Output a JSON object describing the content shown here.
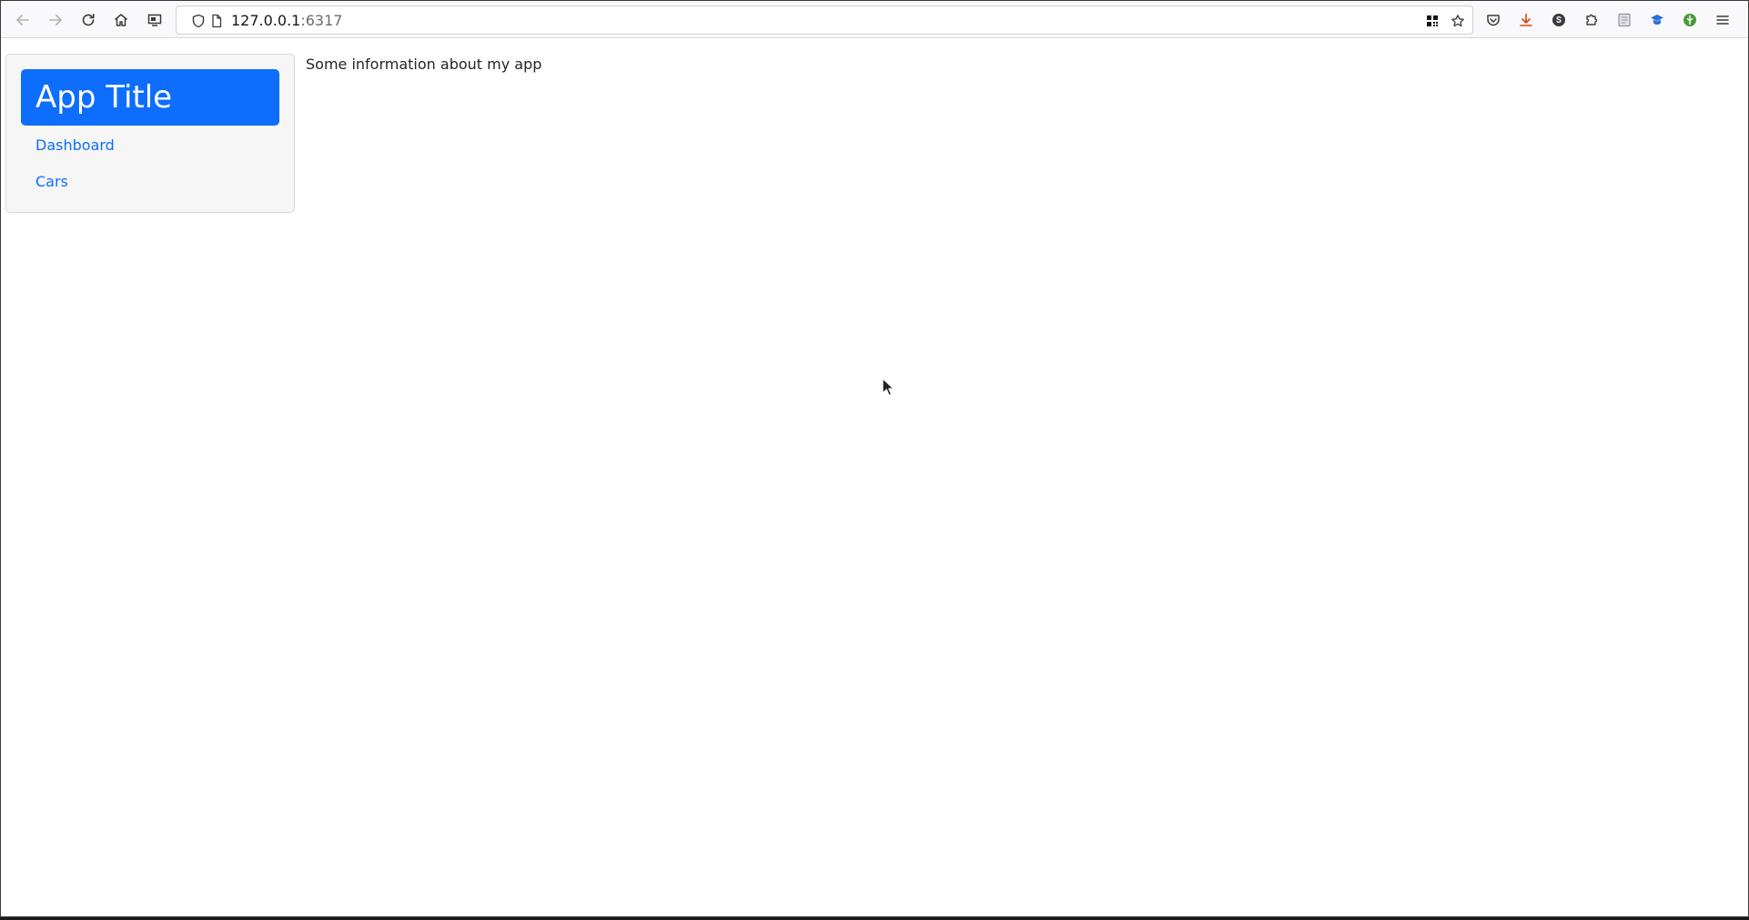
{
  "browser": {
    "url_host": "127.0.0.1",
    "url_port": ":6317",
    "icons": {
      "back": "arrow-left-icon",
      "forward": "arrow-right-icon",
      "reload": "reload-icon",
      "home": "home-icon",
      "screenshot": "screenshot-icon",
      "shield": "shield-icon",
      "page": "page-icon",
      "qr": "qr-code-icon",
      "bookmark": "star-icon",
      "pocket": "pocket-icon",
      "downloads": "download-icon",
      "account": "account-icon",
      "extensions": "puzzle-icon",
      "reader": "reader-icon",
      "extension_blue": "cap-icon",
      "extension_green": "leaf-icon",
      "menu": "hamburger-menu-icon"
    },
    "colors": {
      "download_accent": "#e0431b",
      "toolbar_bg": "#f9f9fb"
    }
  },
  "app": {
    "title": "App Title",
    "nav": [
      {
        "label": "Dashboard"
      },
      {
        "label": "Cars"
      }
    ],
    "info_text": "Some information about my app",
    "colors": {
      "primary": "#0d6efd",
      "sidebar_bg": "#f6f6f6",
      "text": "#212529"
    }
  }
}
